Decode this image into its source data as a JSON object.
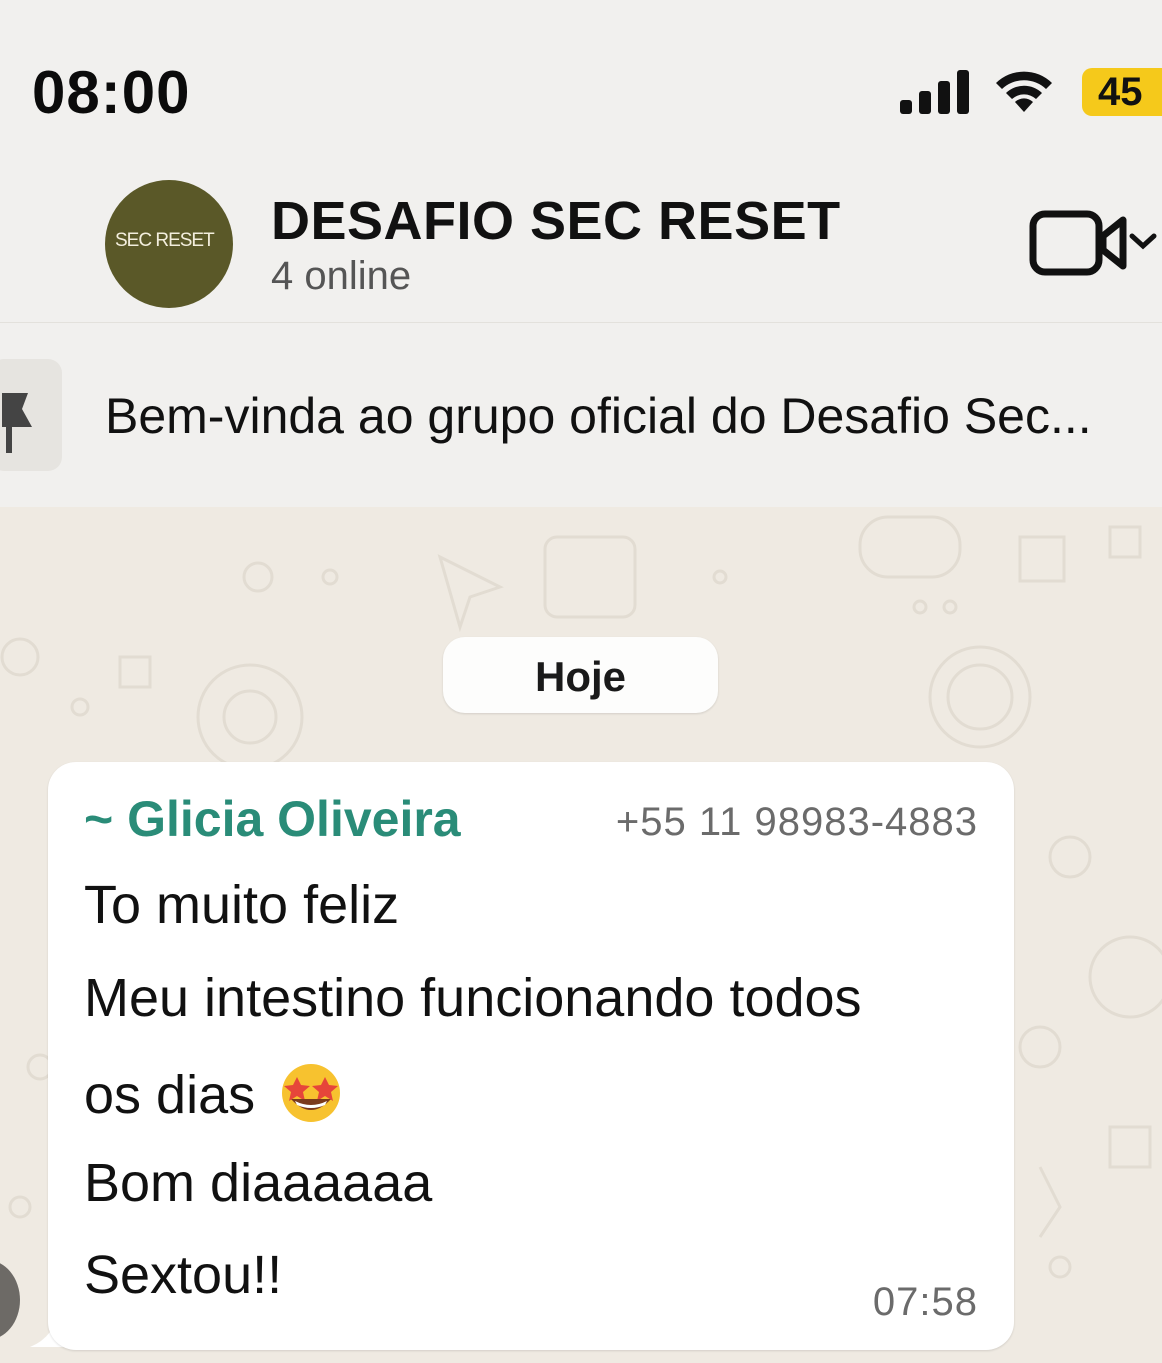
{
  "status_bar": {
    "time": "08:00",
    "battery": "45",
    "battery_color": "#f5c91b",
    "icons": [
      "signal-icon",
      "wifi-icon",
      "battery-icon"
    ]
  },
  "header": {
    "avatar_text": "SEC RESET",
    "title": "DESAFIO SEC RESET",
    "subtitle": "4 online",
    "icons": [
      "video-call-icon",
      "chevron-down-icon"
    ]
  },
  "pinned": {
    "text": "Bem-vinda ao grupo oficial do Desafio Sec...",
    "icon": "pin-icon"
  },
  "chat": {
    "date_chip": "Hoje",
    "message": {
      "sender": "~ Glicia Oliveira",
      "sender_color": "#2a8c78",
      "phone": "+55 11 98983-4883",
      "lines": [
        "To muito feliz",
        "Meu intestino funcionando todos",
        "os dias",
        "Bom diaaaaaa",
        "Sextou!!"
      ],
      "emoji": "star-struck-emoji",
      "time": "07:58"
    }
  }
}
